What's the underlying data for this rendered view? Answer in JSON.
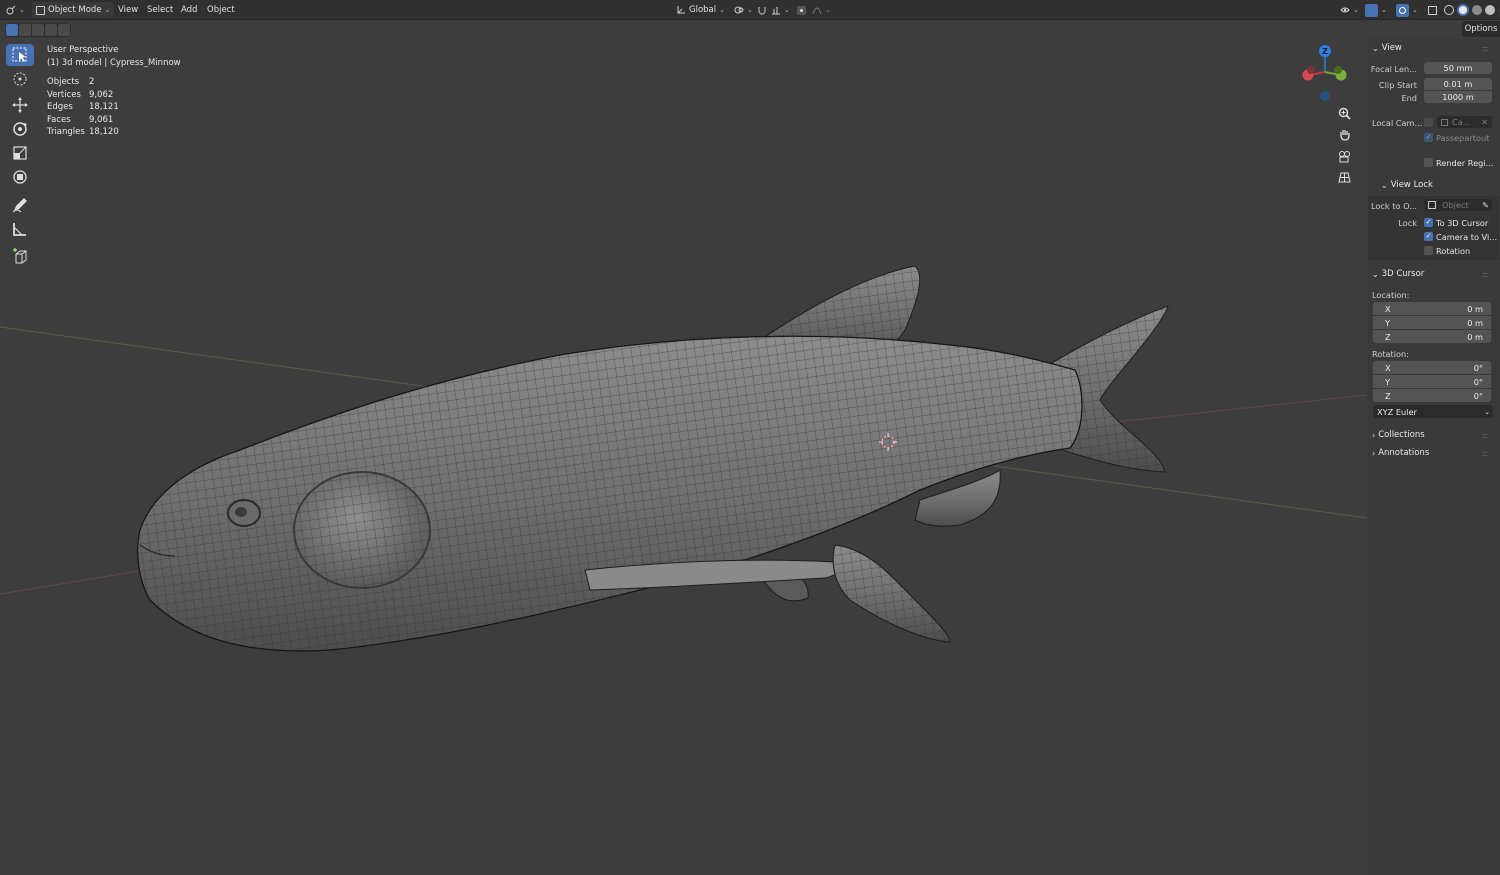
{
  "header": {
    "mode": "Object Mode",
    "menus": [
      "View",
      "Select",
      "Add",
      "Object"
    ],
    "transform_orientation": "Global"
  },
  "overlay": {
    "perspective": "User Perspective",
    "collection_object": "(1) 3d model | Cypress_Minnow",
    "stats": [
      {
        "label": "Objects",
        "value": "2"
      },
      {
        "label": "Vertices",
        "value": "9,062"
      },
      {
        "label": "Edges",
        "value": "18,121"
      },
      {
        "label": "Faces",
        "value": "9,061"
      },
      {
        "label": "Triangles",
        "value": "18,120"
      }
    ]
  },
  "gizmo": {
    "z_label": "Z"
  },
  "sidebar": {
    "options_tab": "Options",
    "view_panel": {
      "title": "View",
      "focal_length_label": "Focal Len...",
      "focal_length_value": "50 mm",
      "clip_start_label": "Clip Start",
      "clip_start_value": "0.01 m",
      "end_label": "End",
      "end_value": "1000 m",
      "local_camera_label": "Local Cam...",
      "local_camera_value": "Ca...",
      "passepartout_label": "Passepartout",
      "render_region_label": "Render Regi..."
    },
    "view_lock": {
      "title": "View Lock",
      "lock_to_object_label": "Lock to O...",
      "lock_to_object_placeholder": "Object",
      "lock_label": "Lock",
      "to_3d_cursor_label": "To 3D Cursor",
      "camera_to_view_label": "Camera to Vi...",
      "rotation_label": "Rotation"
    },
    "cursor_panel": {
      "title": "3D Cursor",
      "location_label": "Location:",
      "location": [
        {
          "axis": "X",
          "value": "0 m"
        },
        {
          "axis": "Y",
          "value": "0 m"
        },
        {
          "axis": "Z",
          "value": "0 m"
        }
      ],
      "rotation_label": "Rotation:",
      "rotation": [
        {
          "axis": "X",
          "value": "0°"
        },
        {
          "axis": "Y",
          "value": "0°"
        },
        {
          "axis": "Z",
          "value": "0°"
        }
      ],
      "rotation_mode": "XYZ Euler"
    },
    "collections_label": "Collections",
    "annotations_label": "Annotations"
  },
  "colors": {
    "accent": "#4772b3",
    "viewport_bg": "#3d3d3d",
    "panel_bg": "#3a3a3a",
    "header_bg": "#303030"
  }
}
